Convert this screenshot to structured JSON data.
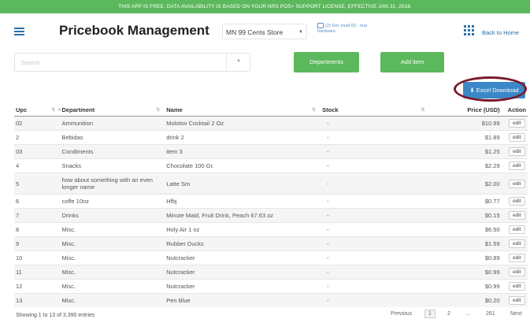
{
  "banner": "THIS APP IS FREE. DATA AVAILABILITY IS BASED ON YOUR NRS POS+ SUPPORT LICENSE, EFFECTIVE JAN 31, 2018.",
  "header": {
    "title": "Pricebook Management",
    "store": "MN 99 Cents Store",
    "device_line1": "(2) Dev Israil 03 - real",
    "device_line2": "hardware",
    "back_home": "Back to Home"
  },
  "toolbar": {
    "search_placeholder": "Search",
    "departments_label": "Departments",
    "add_item_label": "Add item",
    "excel_label": "Excel Download"
  },
  "table": {
    "headers": [
      "Upc",
      "Department",
      "Name",
      "Stock",
      "Price (USD)",
      "Action"
    ],
    "rows": [
      {
        "upc": "02",
        "department": "Ammunition",
        "name": "Molotov Cocktail 2 Oz",
        "stock": "-",
        "price": "$10.99",
        "action": "edit"
      },
      {
        "upc": "2",
        "department": "Bebidas",
        "name": "drink 2",
        "stock": "-",
        "price": "$1.89",
        "action": "edit"
      },
      {
        "upc": "03",
        "department": "Condiments",
        "name": "item 3",
        "stock": "-",
        "price": "$1.25",
        "action": "edit"
      },
      {
        "upc": "4",
        "department": "Snacks",
        "name": "Chocolate 100 Gr.",
        "stock": "-",
        "price": "$2.29",
        "action": "edit"
      },
      {
        "upc": "5",
        "department": "how about something with an even longer name",
        "name": "Latte Sm",
        "stock": "-",
        "price": "$2.00",
        "action": "edit"
      },
      {
        "upc": "6",
        "department": "coffe 10oz",
        "name": "Hfbj",
        "stock": "-",
        "price": "$0.77",
        "action": "edit"
      },
      {
        "upc": "7",
        "department": "Drinks",
        "name": "Minute Maid, Fruit Drink, Peach 67.63 oz",
        "stock": "-",
        "price": "$0.15",
        "action": "edit"
      },
      {
        "upc": "8",
        "department": "Misc.",
        "name": "Holy Air 1 oz",
        "stock": "-",
        "price": "$6.50",
        "action": "edit"
      },
      {
        "upc": "9",
        "department": "Misc.",
        "name": "Rubber Ducks",
        "stock": "-",
        "price": "$1.59",
        "action": "edit"
      },
      {
        "upc": "10",
        "department": "Misc.",
        "name": "Nutcracker",
        "stock": "-",
        "price": "$0.89",
        "action": "edit"
      },
      {
        "upc": "11",
        "department": "Misc.",
        "name": "Nutcracker",
        "stock": "-",
        "price": "$0.99",
        "action": "edit"
      },
      {
        "upc": "12",
        "department": "Misc.",
        "name": "Nutcracker",
        "stock": "-",
        "price": "$0.99",
        "action": "edit"
      },
      {
        "upc": "13",
        "department": "Misc.",
        "name": "Pen Blue",
        "stock": "-",
        "price": "$0.20",
        "action": "edit"
      }
    ]
  },
  "footer": {
    "info": "Showing 1 to 13 of 3,390 entries",
    "previous": "Previous",
    "page1": "1",
    "page2": "2",
    "ellipsis": "...",
    "last_page": "261",
    "next": "Next"
  }
}
